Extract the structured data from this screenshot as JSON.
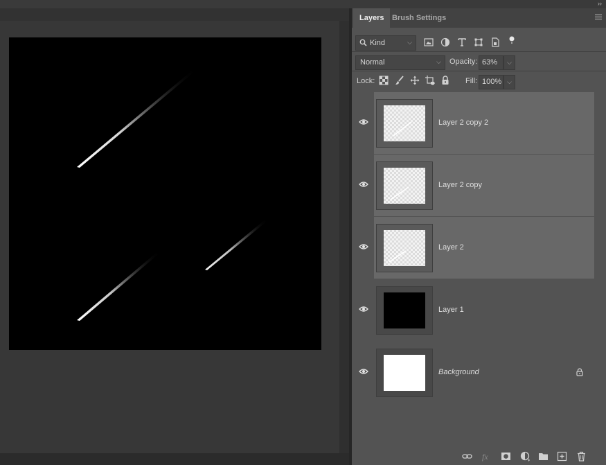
{
  "tabs": [
    {
      "label": "Layers",
      "active": true
    },
    {
      "label": "Brush Settings",
      "active": false
    }
  ],
  "filter": {
    "kind_label": "Kind"
  },
  "blend_mode": "Normal",
  "opacity": {
    "label": "Opacity:",
    "value": "63%"
  },
  "lock": {
    "label": "Lock:"
  },
  "fill": {
    "label": "Fill:",
    "value": "100%"
  },
  "layers": [
    {
      "name": "Layer 2 copy 2",
      "selected": true,
      "visible": true,
      "thumb": "transparent"
    },
    {
      "name": "Layer 2 copy",
      "selected": true,
      "visible": true,
      "thumb": "transparent"
    },
    {
      "name": "Layer 2",
      "selected": true,
      "visible": true,
      "thumb": "transparent"
    },
    {
      "name": "Layer 1",
      "selected": false,
      "visible": true,
      "thumb": "black"
    },
    {
      "name": "Background",
      "selected": false,
      "visible": true,
      "thumb": "white",
      "locked": true
    }
  ],
  "colors": {
    "panel_bg": "#535353",
    "selection": "#686868",
    "canvas_bg": "#000000"
  }
}
